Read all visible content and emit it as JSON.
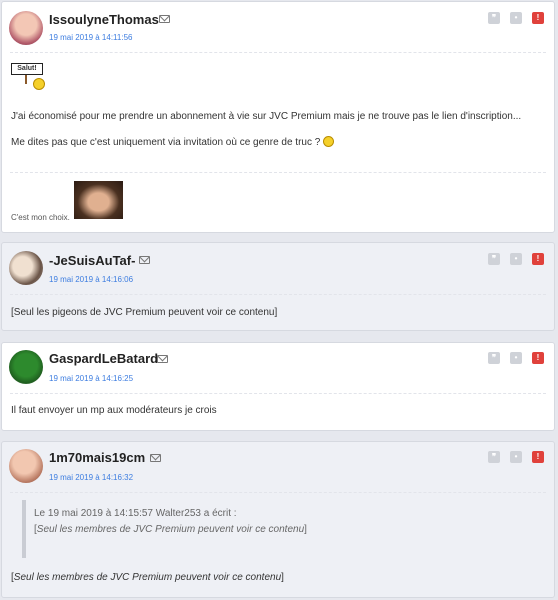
{
  "action_icons": {
    "quote": "quote-icon",
    "neutral": "smiley-neutral-icon",
    "alert": "alert-icon"
  },
  "colors": {
    "date": "#3d7de0",
    "alert": "#e0413b",
    "card_white": "#ffffff",
    "card_grey": "#eef0f5"
  },
  "posts": [
    {
      "author": "IssoulyneThomas",
      "date": "19 mai 2019 à 14:11:56",
      "sticker_text": "Salut!",
      "line1": "J'ai économisé pour me prendre un abonnement à vie sur JVC Premium mais je ne trouve pas le lien d'inscription...",
      "line2": "Me dites pas que c'est uniquement via invitation où ce genre de truc ?",
      "signature": "C'est mon choix."
    },
    {
      "author": "-JeSuisAuTaf-",
      "date": "19 mai 2019 à 14:16:06",
      "message": "[Seul les pigeons de JVC Premium peuvent voir ce contenu]"
    },
    {
      "author": "GaspardLeBatard",
      "date": "19 mai 2019 à 14:16:25",
      "message": "Il faut envoyer un mp aux modérateurs je crois"
    },
    {
      "author": "1m70mais19cm",
      "date": "19 mai 2019 à 14:16:32",
      "quote_header": "Le 19 mai 2019 à 14:15:57 Walter253 a écrit :",
      "quote_open": "[",
      "quote_body": "Seul les membres de JVC Premium peuvent voir ce contenu",
      "quote_close": "]",
      "message_open": "[",
      "message_body": "Seul les membres de JVC Premium peuvent voir ce contenu",
      "message_close": "]"
    }
  ]
}
